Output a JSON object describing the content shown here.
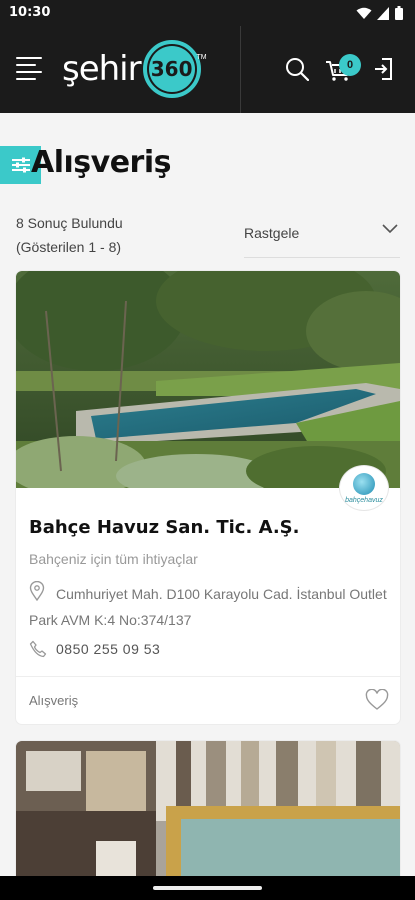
{
  "status_bar": {
    "time": "10:30"
  },
  "header": {
    "logo_word": "şehir",
    "logo_number": "360",
    "logo_tm": "TM",
    "cart_count": "0"
  },
  "page": {
    "title": "Alışveriş"
  },
  "results": {
    "found": "8 Sonuç Bulundu",
    "shown": "(Gösterilen 1 - 8)"
  },
  "sort": {
    "selected": "Rastgele"
  },
  "listings": [
    {
      "name": "Bahçe Havuz San. Tic. A.Ş.",
      "description": "Bahçeniz için tüm ihtiyaçlar",
      "address": "Cumhuriyet Mah. D100 Karayolu Cad. İstanbul Outlet Park AVM K:4 No:374/137",
      "phone": "0850 255 09 53",
      "category": "Alışveriş",
      "brand_logo_text": "bahçehavuz"
    }
  ],
  "colors": {
    "accent": "#3bc9c9",
    "header_bg": "#1b1b1b"
  }
}
